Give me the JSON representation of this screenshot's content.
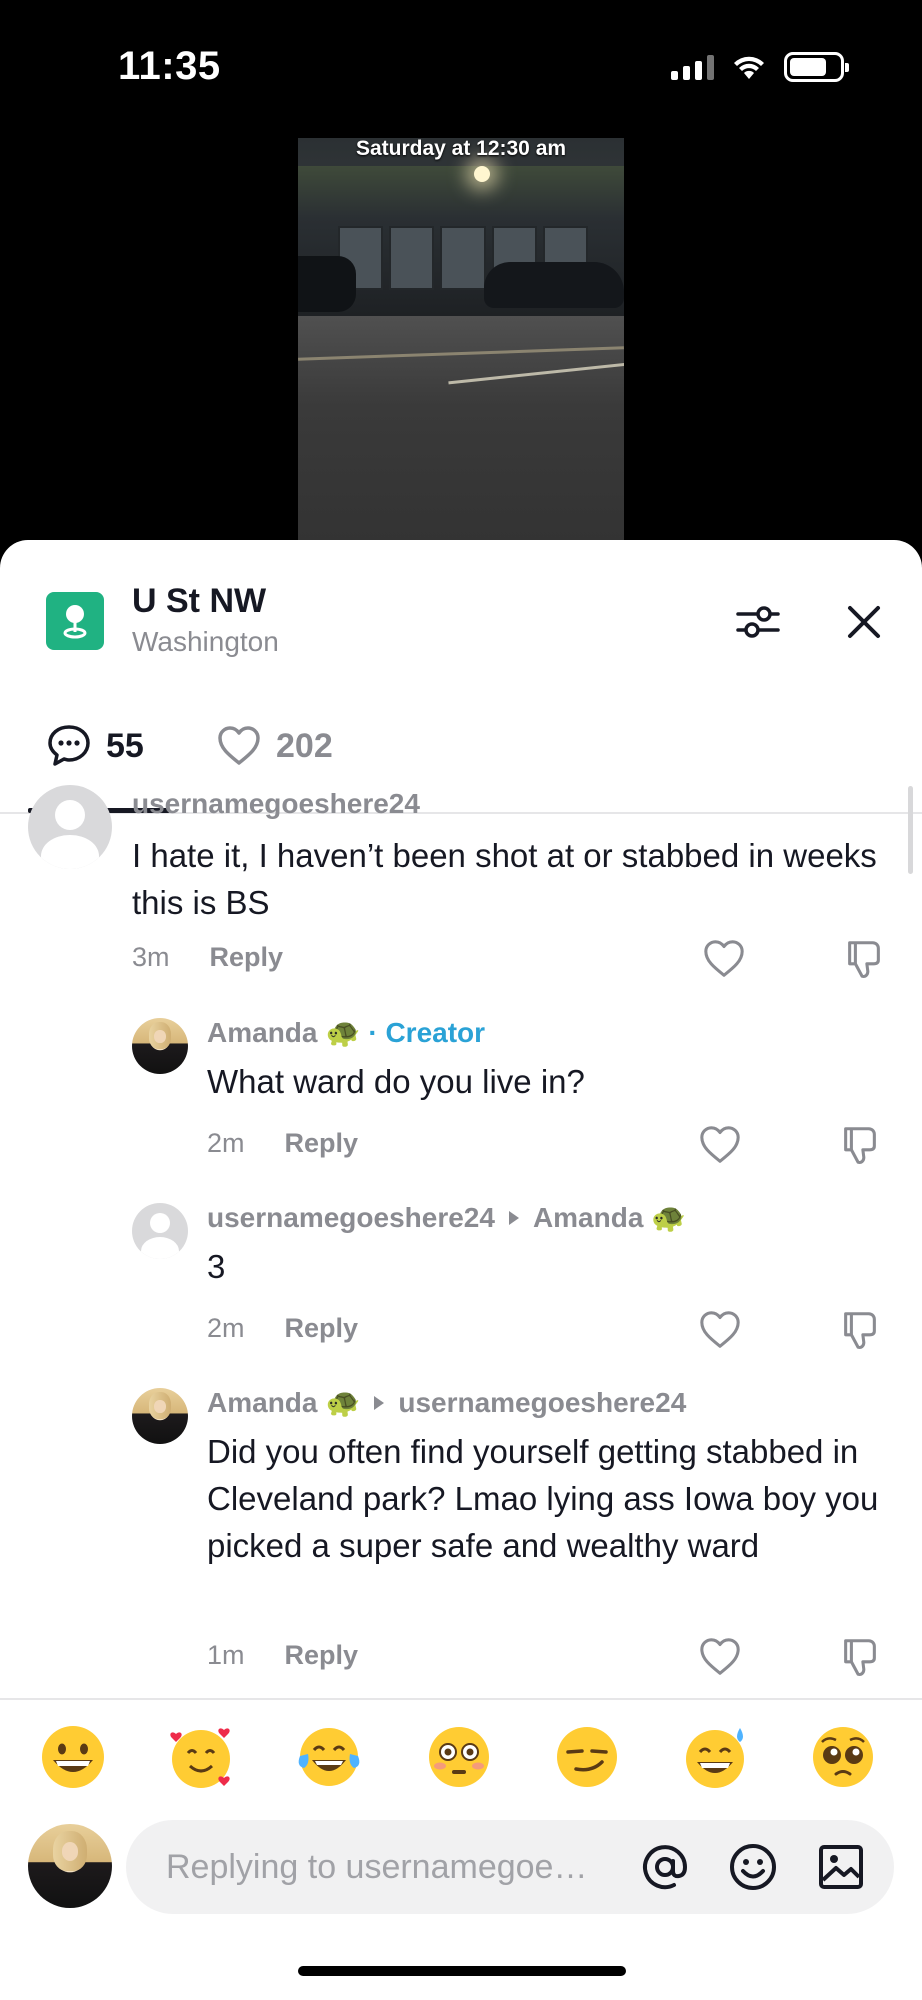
{
  "status_bar": {
    "time": "11:35"
  },
  "video": {
    "caption": "Saturday at 12:30 am"
  },
  "header": {
    "title": "U St NW",
    "subtitle": "Washington"
  },
  "tabs": {
    "comments_count": "55",
    "likes_count": "202"
  },
  "comments": [
    {
      "username": "usernamegoeshere24",
      "text": "I hate it, I haven’t been shot at or stabbed in weeks this is BS",
      "time": "3m",
      "reply": "Reply"
    },
    {
      "username": "Amanda",
      "emoji": "🐢",
      "badge": "· Creator",
      "text": "What ward do you live in?",
      "time": "2m",
      "reply": "Reply"
    },
    {
      "username": "usernamegoeshere24",
      "reply_to": "Amanda",
      "reply_to_emoji": "🐢",
      "text": "3",
      "time": "2m",
      "reply": "Reply"
    },
    {
      "username": "Amanda",
      "emoji": "🐢",
      "reply_to": "usernamegoeshere24",
      "text": "Did you often find yourself getting stabbed in Cleveland park? Lmao lying ass Iowa boy you picked a super safe and wealthy ward",
      "time": "1m",
      "reply": "Reply"
    }
  ],
  "emoji_bar": [
    "grinning-face",
    "smiling-face-with-hearts",
    "face-with-tears-of-joy",
    "flushed-face",
    "smirking-face",
    "grinning-face-with-sweat",
    "pleading-face"
  ],
  "composer": {
    "placeholder": "Replying to usernamegoe…"
  },
  "colors": {
    "creator": "#2aa2d6",
    "place_icon": "#20b282",
    "text": "#161823",
    "muted": "#8a8b91"
  }
}
